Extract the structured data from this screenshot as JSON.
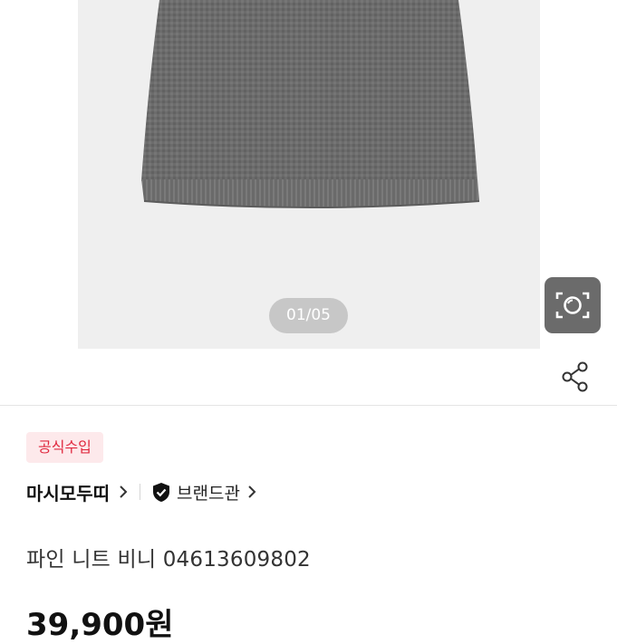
{
  "gallery": {
    "counter": "01/05"
  },
  "product": {
    "badge": "공식수입",
    "brand": "마시모두띠",
    "brand_hall": "브랜드관",
    "title": "파인 니트 비니 04613609802",
    "price": "39,900원"
  },
  "icons": {
    "lens": "camera-lens-icon",
    "share": "share-icon",
    "brand_chevron": "chevron-right-icon",
    "shield": "shield-check-icon"
  },
  "colors": {
    "badge_text": "#e0293f",
    "badge_bg": "#fde9eb",
    "hero_bg": "#efefef",
    "beanie": "#6e6e6e"
  }
}
